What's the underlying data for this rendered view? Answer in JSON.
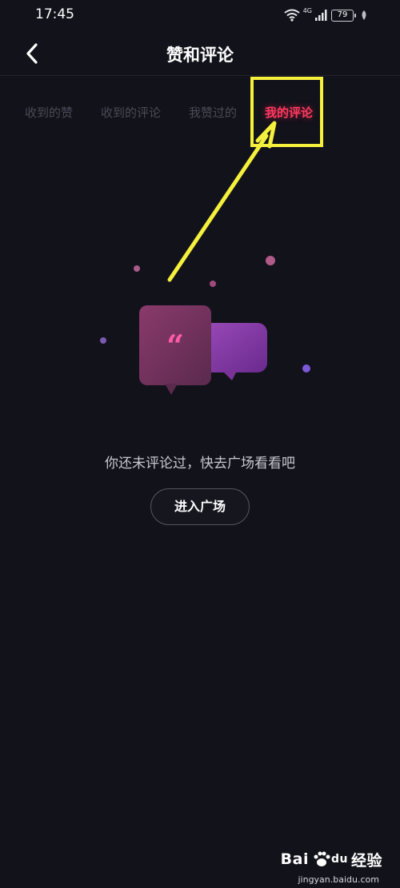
{
  "status": {
    "time": "17:45",
    "network": "4G",
    "battery": "79"
  },
  "header": {
    "title": "赞和评论",
    "back_icon": "chevron-left-icon"
  },
  "tabs": [
    {
      "label": "收到的赞",
      "active": false
    },
    {
      "label": "收到的评论",
      "active": false
    },
    {
      "label": "我赞过的",
      "active": false
    },
    {
      "label": "我的评论",
      "active": true
    }
  ],
  "empty_state": {
    "message": "你还未评论过，快去广场看看吧",
    "button_label": "进入广场",
    "illustration_icon": "quote-bubble-icon"
  },
  "watermark": {
    "brand": "Bai",
    "brand_suffix": "du",
    "label": "经验",
    "url": "jingyan.baidu.com"
  },
  "colors": {
    "background": "#12121a",
    "accent": "#ff3a5f",
    "annotation": "#f4f03c"
  }
}
